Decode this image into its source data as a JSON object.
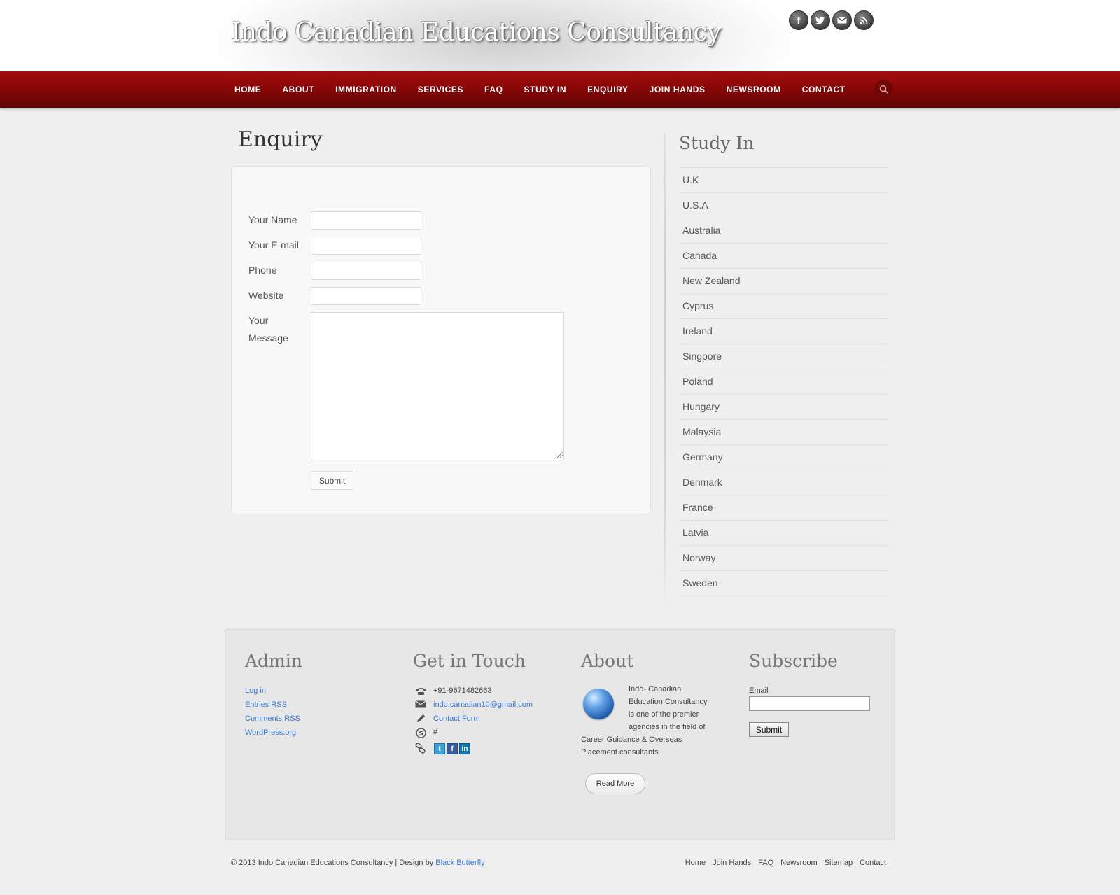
{
  "header": {
    "site_title": "Indo Canadian Educations Consultancy",
    "social_icons": [
      "facebook-icon",
      "twitter-icon",
      "email-icon",
      "rss-icon"
    ]
  },
  "nav": {
    "items": [
      "HOME",
      "ABOUT",
      "IMMIGRATION",
      "SERVICES",
      "FAQ",
      "STUDY IN",
      "ENQUIRY",
      "JOIN HANDS",
      "NEWSROOM",
      "CONTACT"
    ],
    "search_icon": "search-icon"
  },
  "main": {
    "title": "Enquiry",
    "form": {
      "name_label": "Your Name",
      "email_label": "Your E-mail",
      "phone_label": "Phone",
      "website_label": "Website",
      "message_label_1": "Your",
      "message_label_2": "Message",
      "name_value": "",
      "email_value": "",
      "phone_value": "",
      "website_value": "",
      "message_value": "",
      "submit_label": "Submit"
    }
  },
  "sidebar": {
    "title": "Study In",
    "items": [
      "U.K",
      "U.S.A",
      "Australia",
      "Canada",
      "New Zealand",
      "Cyprus",
      "Ireland",
      "Singpore",
      "Poland",
      "Hungary",
      "Malaysia",
      "Germany",
      "Denmark",
      "France",
      "Latvia",
      "Norway",
      "Sweden"
    ]
  },
  "footer": {
    "admin": {
      "title": "Admin",
      "links": [
        "Log in",
        "Entries RSS",
        "Comments RSS",
        "WordPress.org"
      ]
    },
    "touch": {
      "title": "Get in Touch",
      "phone": "+91-9671482663",
      "email": "indo.canadian10@gmail.com",
      "contact_form": "Contact Form",
      "skype": "#"
    },
    "about": {
      "title": "About",
      "line1": "Indo- Canadian",
      "line2": "Education Consultancy",
      "line3": "is one of the premier",
      "line4": "agencies in the field of",
      "line5": "Career Guidance & Overseas",
      "line6": "Placement consultants.",
      "read_more": "Read More"
    },
    "subscribe": {
      "title": "Subscribe",
      "email_label": "Email",
      "email_value": "",
      "submit_label": "Submit"
    }
  },
  "bottom": {
    "copyright": "© 2013 Indo Canadian Educations Consultancy | Design by",
    "designer": "Black Butterfly",
    "links": [
      "Home",
      "Join Hands",
      "FAQ",
      "Newsroom",
      "Sitemap",
      "Contact"
    ]
  }
}
